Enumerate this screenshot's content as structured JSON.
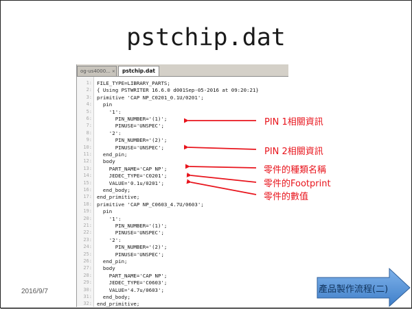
{
  "slide": {
    "title": "pstchip.dat",
    "date": "2016/9/7",
    "nav_button_label": "產品製作流程(二)"
  },
  "editor": {
    "tabs": [
      {
        "label": "og-us4000..."
      },
      {
        "label": "pstchip.dat"
      }
    ],
    "lines": [
      {
        "n": "1:",
        "text": "FILE_TYPE=LIBRARY_PARTS;"
      },
      {
        "n": "2:",
        "text": "{ Using PSTWRITER 16.6.0 d001Sep-05-2016 at 09:20:21}"
      },
      {
        "n": "3:",
        "text": "primitive 'CAP NP_C0201_0.1U/0201';"
      },
      {
        "n": "4:",
        "text": "  pin"
      },
      {
        "n": "5:",
        "text": "    '1':"
      },
      {
        "n": "6:",
        "text": "      PIN_NUMBER='(1)';"
      },
      {
        "n": "7:",
        "text": "      PINUSE='UNSPEC';"
      },
      {
        "n": "8:",
        "text": "    '2':"
      },
      {
        "n": "9:",
        "text": "      PIN_NUMBER='(2)';"
      },
      {
        "n": "10:",
        "text": "      PINUSE='UNSPEC';"
      },
      {
        "n": "11:",
        "text": "  end_pin;"
      },
      {
        "n": "12:",
        "text": "  body"
      },
      {
        "n": "13:",
        "text": "    PART_NAME='CAP NP';"
      },
      {
        "n": "14:",
        "text": "    JEDEC_TYPE='C0201';"
      },
      {
        "n": "15:",
        "text": "    VALUE='0.1u/0201';"
      },
      {
        "n": "16:",
        "text": "  end_body;"
      },
      {
        "n": "17:",
        "text": "end_primitive;"
      },
      {
        "n": "18:",
        "text": "primitive 'CAP NP_C0603_4.7U/0603';"
      },
      {
        "n": "19:",
        "text": "  pin"
      },
      {
        "n": "20:",
        "text": "    '1':"
      },
      {
        "n": "21:",
        "text": "      PIN_NUMBER='(1)';"
      },
      {
        "n": "22:",
        "text": "      PINUSE='UNSPEC';"
      },
      {
        "n": "23:",
        "text": "    '2':"
      },
      {
        "n": "24:",
        "text": "      PIN_NUMBER='(2)';"
      },
      {
        "n": "25:",
        "text": "      PINUSE='UNSPEC';"
      },
      {
        "n": "26:",
        "text": "  end_pin;"
      },
      {
        "n": "27:",
        "text": "  body"
      },
      {
        "n": "28:",
        "text": "    PART_NAME='CAP NP';"
      },
      {
        "n": "29:",
        "text": "    JEDEC_TYPE='C0603';"
      },
      {
        "n": "30:",
        "text": "    VALUE='4.7u/0603';"
      },
      {
        "n": "31:",
        "text": "  end_body;"
      },
      {
        "n": "32:",
        "text": "end_primitive;"
      }
    ]
  },
  "annotations": [
    {
      "label": "PIN 1相關資訊"
    },
    {
      "label": "PIN 2相關資訊"
    },
    {
      "label": "零件的種類名稱"
    },
    {
      "label": "零件的Footprint"
    },
    {
      "label": "零件的數值"
    }
  ],
  "colors": {
    "annotation_red": "#e8141c",
    "nav_button_blue": "#4f8fd6"
  }
}
